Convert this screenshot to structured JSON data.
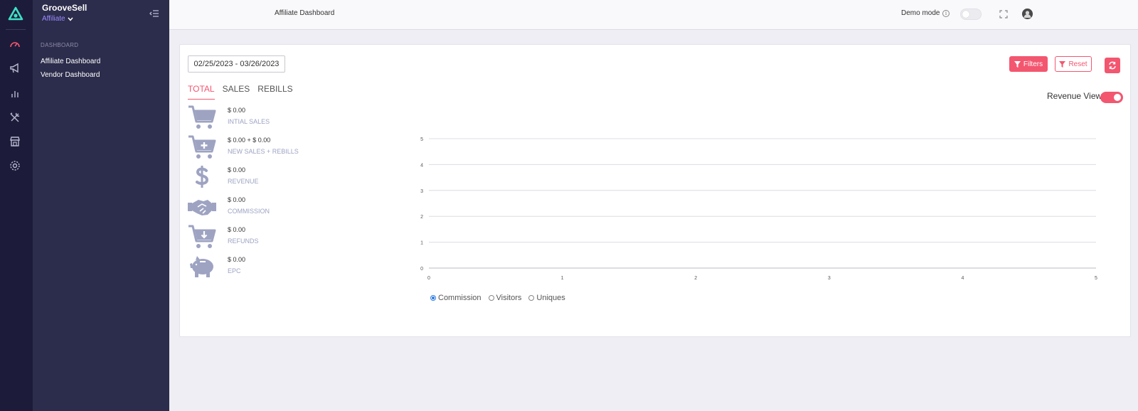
{
  "app": {
    "name": "GrooveSell",
    "role": "Affiliate"
  },
  "sidebar": {
    "section_label": "DASHBOARD",
    "items": [
      {
        "label": "Affiliate Dashboard"
      },
      {
        "label": "Vendor Dashboard"
      }
    ]
  },
  "rail_icons": [
    "dashboard-gauge-icon",
    "megaphone-icon",
    "bar-chart-icon",
    "tools-icon",
    "store-icon",
    "gear-icon"
  ],
  "topbar": {
    "title": "Affiliate Dashboard",
    "demo_mode_label": "Demo mode",
    "demo_mode_on": false
  },
  "filters": {
    "date_range": "02/25/2023 - 03/26/2023",
    "filters_label": "Filters",
    "reset_label": "Reset"
  },
  "tabs": [
    {
      "label": "TOTAL",
      "active": true
    },
    {
      "label": "SALES",
      "active": false
    },
    {
      "label": "REBILLS",
      "active": false
    }
  ],
  "revenue_view": {
    "label": "Revenue View",
    "on": true
  },
  "stats": [
    {
      "icon": "cart-icon",
      "value": "$ 0.00",
      "label": "INTIAL SALES"
    },
    {
      "icon": "cart-plus-icon",
      "value": "$ 0.00 + $ 0.00",
      "label": "NEW SALES + REBILLS"
    },
    {
      "icon": "dollar-icon",
      "value": "$ 0.00",
      "label": "REVENUE"
    },
    {
      "icon": "handshake-icon",
      "value": "$ 0.00",
      "label": "COMMISSION"
    },
    {
      "icon": "cart-refund-icon",
      "value": "$ 0.00",
      "label": "REFUNDS"
    },
    {
      "icon": "piggy-bank-icon",
      "value": "$ 0.00",
      "label": "EPC"
    }
  ],
  "legend": [
    {
      "label": "Commission",
      "selected": true
    },
    {
      "label": "Visitors",
      "selected": false
    },
    {
      "label": "Uniques",
      "selected": false
    }
  ],
  "colors": {
    "accent": "#f3566f",
    "rail": "#1c1c3a",
    "sidebar": "#2c2c4c",
    "role": "#9b8cff",
    "radio": "#2f7de1"
  },
  "chart_data": {
    "type": "line",
    "x": [],
    "series": [],
    "x_ticks": [
      "0",
      "1",
      "2",
      "3",
      "4",
      "5"
    ],
    "y_ticks": [
      "0",
      "1",
      "2",
      "3",
      "4",
      "5"
    ],
    "xlim": [
      0,
      5
    ],
    "ylim": [
      0,
      5
    ],
    "grid": true
  }
}
